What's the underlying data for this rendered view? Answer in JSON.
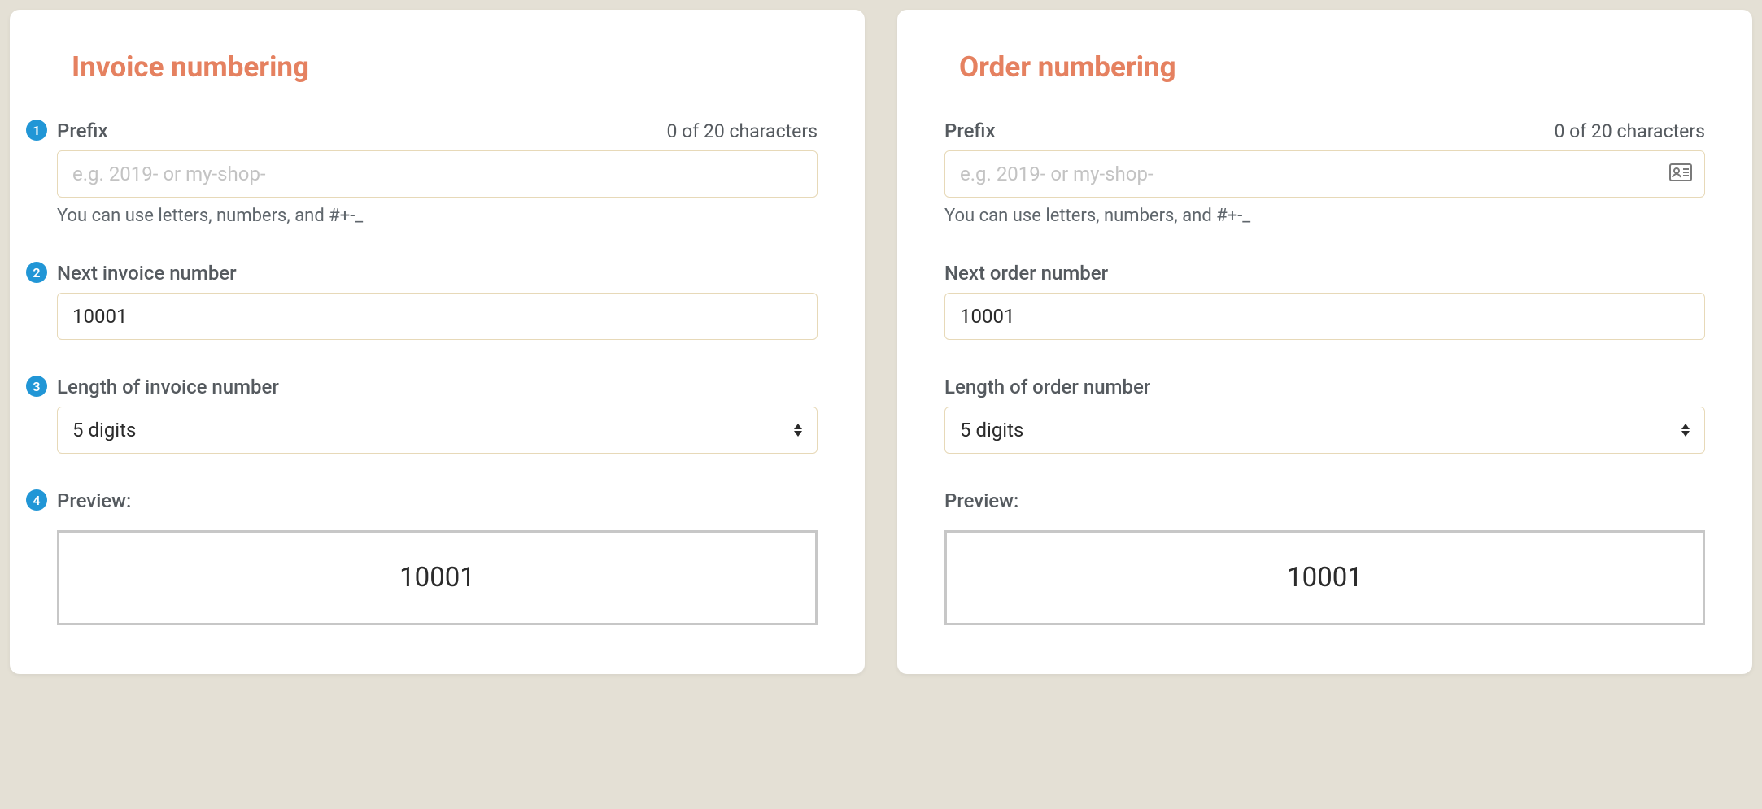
{
  "colors": {
    "accent": "#e58160",
    "badge": "#2196d6",
    "border_input": "#e7d9b8",
    "border_preview": "#c7c7c7",
    "bg": "#e4e0d5"
  },
  "invoice": {
    "title": "Invoice numbering",
    "prefix": {
      "step": "1",
      "label": "Prefix",
      "char_count": "0 of 20 characters",
      "placeholder": "e.g. 2019- or my-shop-",
      "value": "",
      "hint": "You can use letters, numbers, and #+-_"
    },
    "next_number": {
      "step": "2",
      "label": "Next invoice number",
      "value": "10001"
    },
    "length": {
      "step": "3",
      "label": "Length of invoice number",
      "value": "5 digits"
    },
    "preview": {
      "step": "4",
      "label": "Preview:",
      "value": "10001"
    }
  },
  "order": {
    "title": "Order numbering",
    "prefix": {
      "label": "Prefix",
      "char_count": "0 of 20 characters",
      "placeholder": "e.g. 2019- or my-shop-",
      "value": "",
      "hint": "You can use letters, numbers, and #+-_",
      "suffix_icon": "id-card-icon"
    },
    "next_number": {
      "label": "Next order number",
      "value": "10001"
    },
    "length": {
      "label": "Length of order number",
      "value": "5 digits"
    },
    "preview": {
      "label": "Preview:",
      "value": "10001"
    }
  }
}
